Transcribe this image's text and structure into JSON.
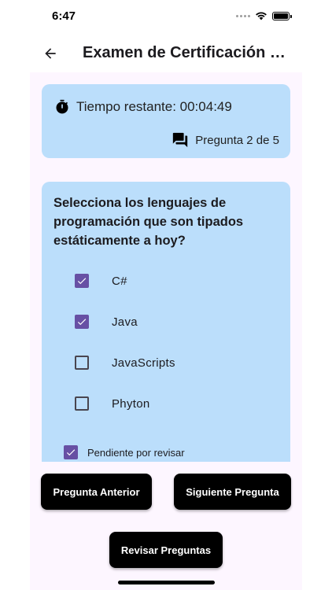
{
  "status_bar": {
    "time": "6:47"
  },
  "app_bar": {
    "title": "Examen de Certificación S..."
  },
  "timer_card": {
    "timer_text": "Tiempo restante: 00:04:49",
    "question_count": "Pregunta 2 de 5"
  },
  "question": {
    "text": "Selecciona los lenguajes de programación que son tipados estáticamente a hoy?",
    "options": [
      {
        "label": "C#",
        "checked": true
      },
      {
        "label": "Java",
        "checked": true
      },
      {
        "label": "JavaScripts",
        "checked": false
      },
      {
        "label": "Phyton",
        "checked": false
      }
    ],
    "review_label": "Pendiente por revisar",
    "review_checked": true
  },
  "buttons": {
    "previous": "Pregunta Anterior",
    "next": "Siguiente Pregunta",
    "review": "Revisar Preguntas"
  },
  "colors": {
    "card_background": "#bbdefb",
    "checkbox_accent": "#6750a4",
    "button_background": "#000000",
    "page_background": "#fdf6ff"
  }
}
